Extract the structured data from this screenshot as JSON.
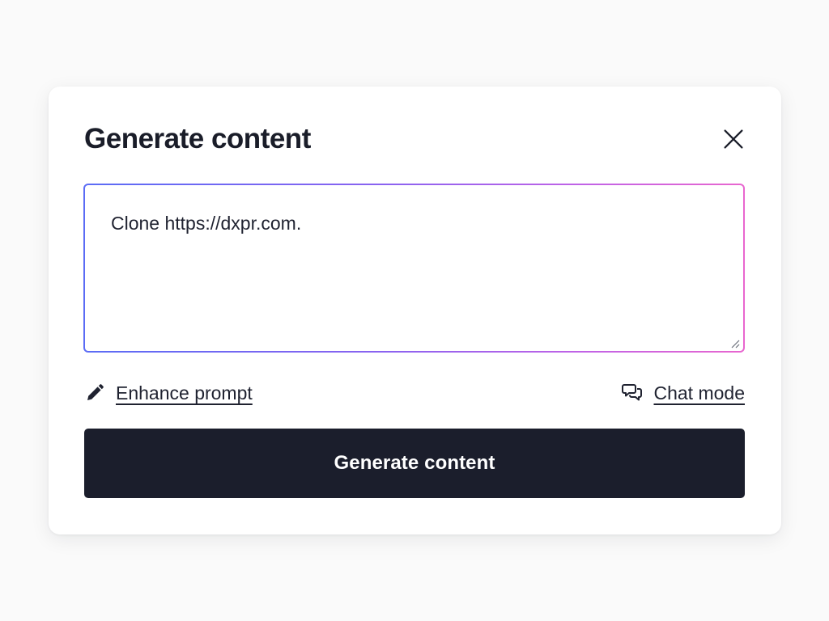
{
  "modal": {
    "title": "Generate content",
    "close_icon": "close-icon",
    "prompt": {
      "value": "Clone https://dxpr.com."
    },
    "enhance_prompt": {
      "icon": "pencil-icon",
      "label": "Enhance prompt"
    },
    "chat_mode": {
      "icon": "chat-bubbles-icon",
      "label": "Chat mode"
    },
    "generate_button": {
      "label": "Generate content"
    }
  },
  "colors": {
    "title_text": "#1a1d29",
    "primary_button_bg": "#1b1e2c",
    "primary_button_text": "#ffffff",
    "gradient_start": "#5b6cf5",
    "gradient_end": "#e866cf",
    "modal_bg": "#ffffff",
    "page_bg": "#fafafa"
  }
}
